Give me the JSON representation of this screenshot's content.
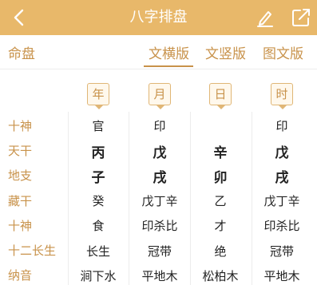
{
  "header": {
    "title": "八字排盘",
    "back_icon": "chevron-left-icon",
    "edit_icon": "pencil-icon",
    "share_icon": "share-icon"
  },
  "tabs": {
    "left": "命盘",
    "items": [
      "文横版",
      "文竖版",
      "图文版"
    ],
    "active": "文横版"
  },
  "columns": [
    "年",
    "月",
    "日",
    "时"
  ],
  "rows": [
    {
      "label": "十神",
      "cells": [
        "官",
        "印",
        "",
        "印"
      ]
    },
    {
      "label": "天干",
      "cells": [
        "丙",
        "戊",
        "辛",
        "戊"
      ]
    },
    {
      "label": "地支",
      "cells": [
        "子",
        "戌",
        "卯",
        "戌"
      ]
    },
    {
      "label": "藏干",
      "cells": [
        "癸",
        "戊丁辛",
        "乙",
        "戊丁辛"
      ]
    },
    {
      "label": "十神",
      "cells": [
        "食",
        "印杀比",
        "才",
        "印杀比"
      ]
    },
    {
      "label": "十二长生",
      "cells": [
        "长生",
        "冠带",
        "绝",
        "冠带"
      ]
    },
    {
      "label": "纳音",
      "cells": [
        "涧下水",
        "平地木",
        "松柏木",
        "平地木"
      ]
    }
  ],
  "colors": {
    "topbar": "#e8b86a",
    "accent": "#c8924a",
    "text": "#222222"
  }
}
